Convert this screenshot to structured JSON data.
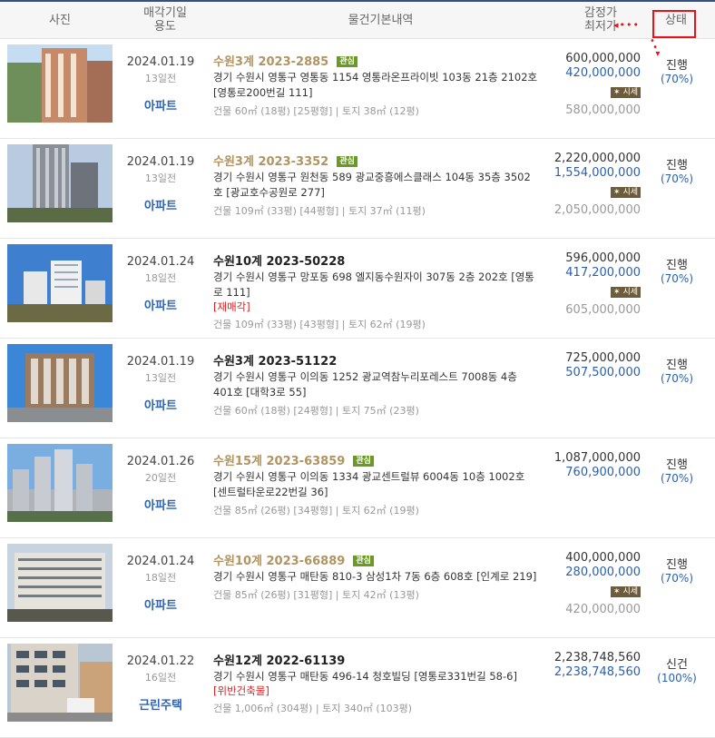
{
  "header": {
    "photo": "사진",
    "date_line1": "매각기일",
    "date_line2": "용도",
    "info": "물건기본내역",
    "price_line1": "감정가",
    "price_line2": "최저가",
    "status": "상태"
  },
  "rows": [
    {
      "date": "2024.01.19",
      "ago": "13일전",
      "use": "아파트",
      "case": "수원3계 2023-2885",
      "badge": "관심",
      "addr": "경기 수원시 영통구 영통동 1154 영통라온프라이빗 103동 21층 2102호 [영통로200번길 111]",
      "flag": "",
      "area": "건물 60㎡ (18평) [25평형]  |  토지 38㎡ (12평)",
      "appraisal": "600,000,000",
      "minimum": "420,000,000",
      "market_badge": "시세",
      "market": "580,000,000",
      "status": "진행",
      "pct": "(70%)"
    },
    {
      "date": "2024.01.19",
      "ago": "13일전",
      "use": "아파트",
      "case": "수원3계 2023-3352",
      "badge": "관심",
      "addr": "경기 수원시 영통구 원천동 589 광교중흥에스클래스 104동 35층 3502호 [광교호수공원로 277]",
      "flag": "",
      "area": "건물 109㎡ (33평) [44평형]  |  토지 37㎡ (11평)",
      "appraisal": "2,220,000,000",
      "minimum": "1,554,000,000",
      "market_badge": "시세",
      "market": "2,050,000,000",
      "status": "진행",
      "pct": "(70%)"
    },
    {
      "date": "2024.01.24",
      "ago": "18일전",
      "use": "아파트",
      "case": "수원10계 2023-50228",
      "badge": "",
      "addr": "경기 수원시 영통구 망포동 698 엘지동수원자이 307동 2층 202호 [영통로 111]",
      "flag": "[재매각]",
      "area": "건물 109㎡ (33평) [43평형]  |  토지 62㎡ (19평)",
      "appraisal": "596,000,000",
      "minimum": "417,200,000",
      "market_badge": "시세",
      "market": "605,000,000",
      "status": "진행",
      "pct": "(70%)"
    },
    {
      "date": "2024.01.19",
      "ago": "13일전",
      "use": "아파트",
      "case": "수원3계 2023-51122",
      "badge": "",
      "addr": "경기 수원시 영통구 이의동 1252 광교역참누리포레스트 7008동 4층 401호 [대학3로 55]",
      "flag": "",
      "area": "건물 60㎡ (18평) [24평형]  |  토지 75㎡ (23평)",
      "appraisal": "725,000,000",
      "minimum": "507,500,000",
      "market_badge": "",
      "market": "",
      "status": "진행",
      "pct": "(70%)"
    },
    {
      "date": "2024.01.26",
      "ago": "20일전",
      "use": "아파트",
      "case": "수원15계 2023-63859",
      "badge": "관심",
      "addr": "경기 수원시 영통구 이의동 1334 광교센트럴뷰 6004동 10층 1002호 [센트럴타운로22번길 36]",
      "flag": "",
      "area": "건물 85㎡ (26평) [34평형]  |  토지 62㎡ (19평)",
      "appraisal": "1,087,000,000",
      "minimum": "760,900,000",
      "market_badge": "",
      "market": "",
      "status": "진행",
      "pct": "(70%)"
    },
    {
      "date": "2024.01.24",
      "ago": "18일전",
      "use": "아파트",
      "case": "수원10계 2023-66889",
      "badge": "관심",
      "addr": "경기 수원시 영통구 매탄동 810-3 삼성1차 7동 6층 608호 [인계로 219]",
      "flag": "",
      "area": "건물 85㎡ (26평) [31평형]  |  토지 42㎡ (13평)",
      "appraisal": "400,000,000",
      "minimum": "280,000,000",
      "market_badge": "시세",
      "market": "420,000,000",
      "status": "진행",
      "pct": "(70%)"
    },
    {
      "date": "2024.01.22",
      "ago": "16일전",
      "use": "근린주택",
      "case": "수원12계 2022-61139",
      "badge": "",
      "addr": "경기 수원시 영통구 매탄동 496-14 청호빌딩 [영통로331번길 58-6]",
      "flag": "[위반건축물]",
      "area": "건물 1,006㎡ (304평)  |  토지 340㎡ (103평)",
      "appraisal": "2,238,748,560",
      "minimum": "2,238,748,560",
      "market_badge": "",
      "market": "",
      "status": "신건",
      "pct": "(100%)"
    }
  ],
  "colors": {
    "accent_red": "#e8121a",
    "case_gold": "#b19461",
    "link_blue": "#2d64b5"
  }
}
